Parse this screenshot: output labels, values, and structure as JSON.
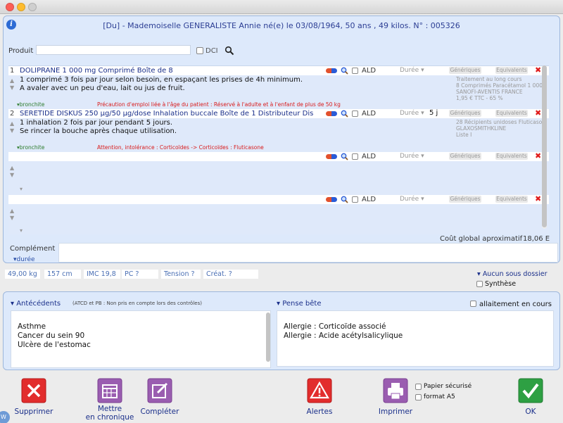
{
  "patient": {
    "title": "[Du] - Mademoiselle GENERALISTE Annie   né(e) le 03/08/1964, 50 ans , 49 kilos.  N° : 005326"
  },
  "search": {
    "label": "Produit",
    "dci_label": "DCI"
  },
  "prescriptions": [
    {
      "num": "1",
      "name": "DOLIPRANE 1 000 mg Comprimé Boîte de 8",
      "ald_label": "ALD",
      "duree_label": "Durée",
      "duree_value": "",
      "generiques_label": "Génériques",
      "equivalents_label": "Equivalents",
      "posology": [
        "1 comprimé 3 fois par jour selon besoin, en espaçant les prises de 4h minimum.",
        "A avaler avec un peu d'eau, lait ou jus de fruit."
      ],
      "info": [
        "Traitement au long cours",
        "8 Comprimés   Paracétamol 1 000",
        "SANOFI-AVENTIS FRANCE",
        "1,95 € TTC - 65 %"
      ],
      "indication": "bronchite",
      "warning": "Précaution d'emploi liée à l'âge du patient : Réservé à l'adulte et à l'enfant de plus de 50 kg"
    },
    {
      "num": "2",
      "name": "SERETIDE DISKUS 250 µg/50 µg/dose Inhalation buccale Boîte de 1 Distributeur Dis",
      "ald_label": "ALD",
      "duree_label": "Durée",
      "duree_value": "5 j",
      "generiques_label": "Génériques",
      "equivalents_label": "Equivalents",
      "posology": [
        "1 inhalation 2 fois par jour pendant 5 jours.",
        "Se rincer la bouche après chaque utilisation."
      ],
      "info": [
        "28 Récipients unidoses  Fluticason",
        "GLAXOSMITHKLINE",
        "Liste I"
      ],
      "indication": "bronchite",
      "warning": "Attention, intolérance : Corticoïdes -> Corticoïdes : Fluticasone"
    },
    {
      "num": "",
      "name": "",
      "ald_label": "ALD",
      "duree_label": "Durée",
      "duree_value": "",
      "generiques_label": "Génériques",
      "equivalents_label": "Equivalents"
    },
    {
      "num": "",
      "name": "",
      "ald_label": "ALD",
      "duree_label": "Durée",
      "duree_value": "",
      "generiques_label": "Génériques",
      "equivalents_label": "Equivalents"
    }
  ],
  "cost": {
    "label": "Coût global aproximatif",
    "value": "18,06 E"
  },
  "complement": {
    "label": "Complément",
    "duree_link": "durée"
  },
  "biometrics": {
    "weight": "49,00 kg",
    "height": "157 cm",
    "imc": "IMC 19,8",
    "pc": "PC ?",
    "tension": "Tension ?",
    "creat": "Créat. ?"
  },
  "dossier": {
    "link": "Aucun sous dossier",
    "synthese_label": "Synthèse"
  },
  "antecedents": {
    "title": "Antécédents",
    "note": "(ATCD et PB : Non pris en compte lors des contrôles)",
    "items": [
      "Asthme",
      "Cancer du sein 90",
      "Ulcère de l'estomac"
    ]
  },
  "pense_bete": {
    "title": "Pense bête",
    "allaitement_label": "allaitement en cours",
    "items": [
      "Allergie : Corticoïde associé",
      "Allergie : Acide acétylsalicylique"
    ]
  },
  "actions": {
    "supprimer": "Supprimer",
    "chronique_line1": "Mettre",
    "chronique_line2": "en chronique",
    "completer": "Compléter",
    "alertes": "Alertes",
    "imprimer": "Imprimer",
    "papier_securise": "Papier sécurisé",
    "format_a5": "format A5",
    "ok": "OK"
  },
  "colors": {
    "panel_bg": "#dde9fb",
    "title_blue": "#2c3e94",
    "warning_red": "#d91a1a",
    "indication_green": "#2c7c2c",
    "delete_red": "#e01b1b",
    "ok_green": "#2ea043",
    "edit_purple": "#8e4fa3"
  }
}
